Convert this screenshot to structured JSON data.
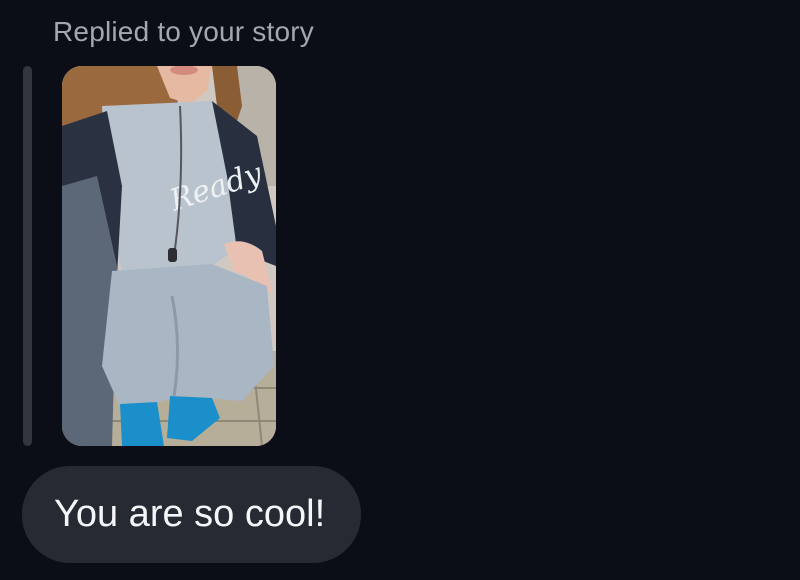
{
  "reply_context": {
    "label": "Replied to your story"
  },
  "story": {
    "image_description": "story photo",
    "sweater_print": "Ready"
  },
  "message": {
    "text": "You are so cool!"
  },
  "colors": {
    "background": "#0b0e16",
    "bubble": "#262a32",
    "reply_bar": "#33363d",
    "label_text": "#a3a7b0",
    "message_text": "#f5f6f8"
  }
}
